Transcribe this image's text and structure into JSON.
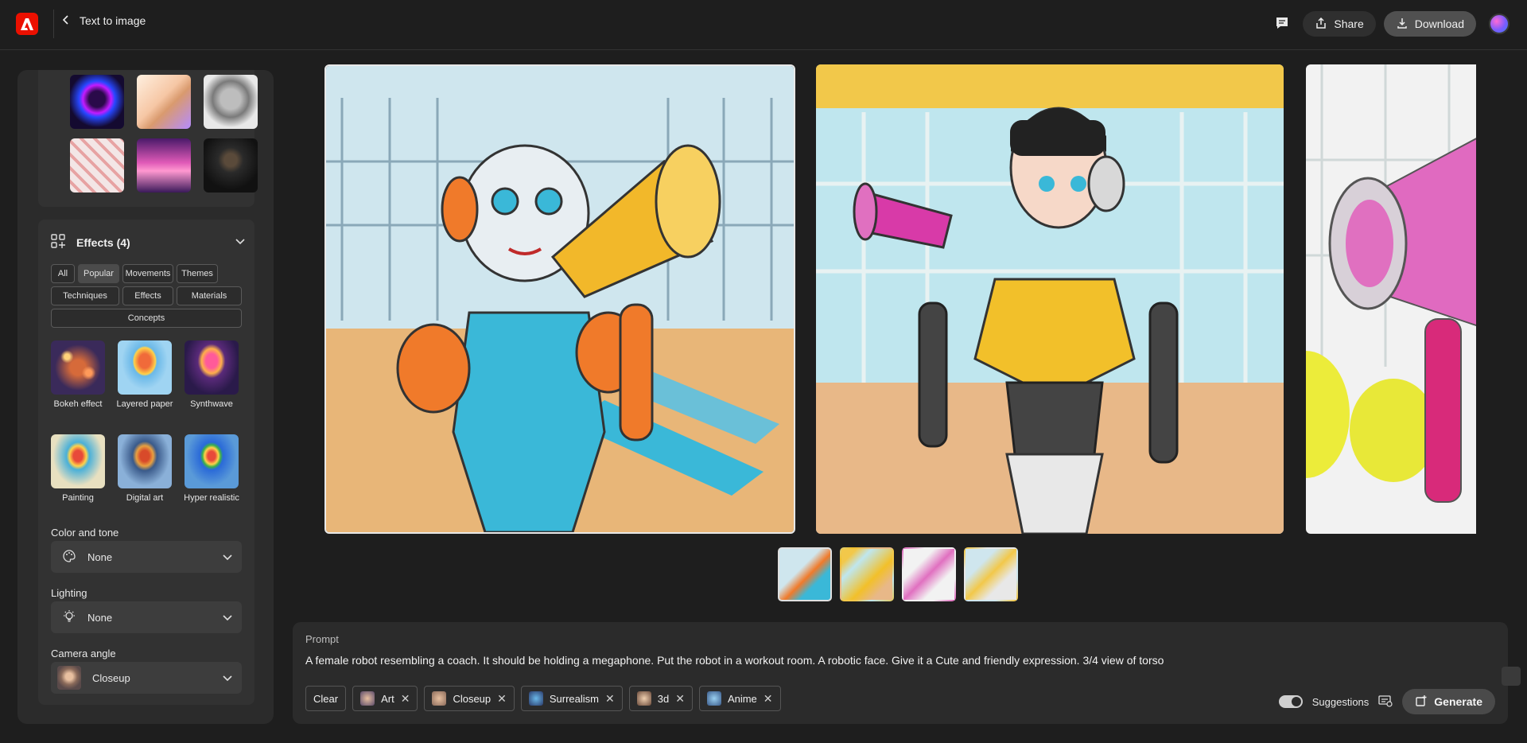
{
  "header": {
    "title": "Text to image",
    "share_label": "Share",
    "download_label": "Download"
  },
  "sidebar": {
    "effects_title": "Effects (4)",
    "filter_chips": [
      "All",
      "Popular",
      "Movements",
      "Themes",
      "Techniques",
      "Effects",
      "Materials",
      "Concepts"
    ],
    "active_chip": "Popular",
    "effects": [
      {
        "label": "Bokeh effect"
      },
      {
        "label": "Layered paper"
      },
      {
        "label": "Synthwave"
      },
      {
        "label": "Painting"
      },
      {
        "label": "Digital art"
      },
      {
        "label": "Hyper realistic"
      }
    ],
    "color_tone": {
      "label": "Color and tone",
      "value": "None"
    },
    "lighting": {
      "label": "Lighting",
      "value": "None"
    },
    "camera_angle": {
      "label": "Camera angle",
      "value": "Closeup"
    }
  },
  "prompt": {
    "label": "Prompt",
    "text": "A female robot resembling a coach. It should be holding a megaphone. Put the robot in a workout room. A robotic face. Give it a Cute and friendly expression. 3/4 view of torso",
    "clear_label": "Clear",
    "tags": [
      "Art",
      "Closeup",
      "Surrealism",
      "3d",
      "Anime"
    ],
    "suggestions_label": "Suggestions",
    "suggestions_on": true,
    "generate_label": "Generate"
  },
  "results": {
    "selected_index": 0,
    "count": 4
  },
  "colors": {
    "accent": "#eb1000",
    "panel": "#2b2b2b",
    "background": "#1e1e1e"
  }
}
